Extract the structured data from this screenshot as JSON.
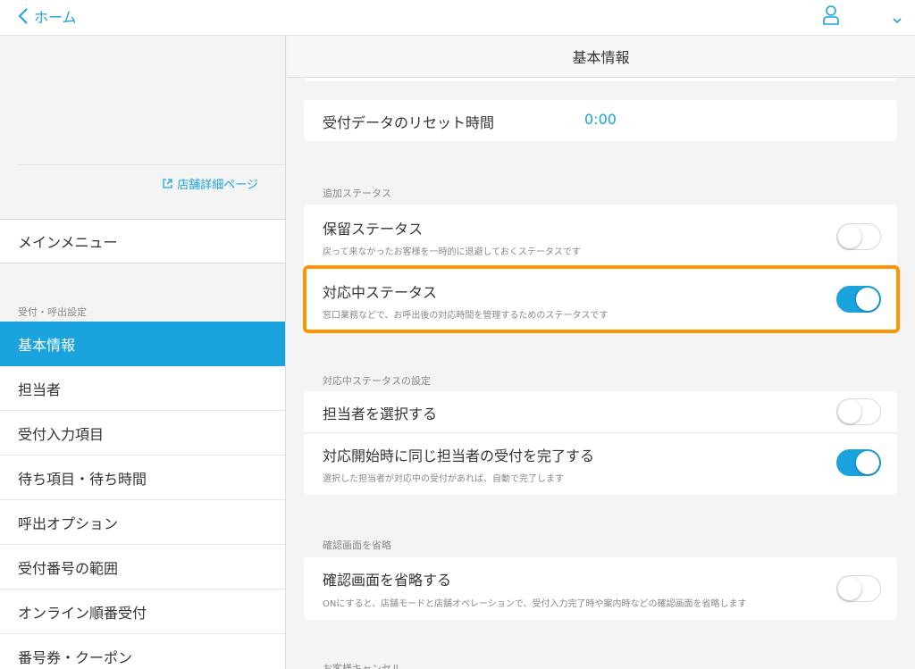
{
  "header": {
    "back_label": "ホーム"
  },
  "sidebar": {
    "store_link_label": "店舗詳細ページ",
    "main_menu_label": "メインメニュー",
    "section_label": "受付・呼出設定",
    "items": [
      {
        "label": "基本情報",
        "active": true
      },
      {
        "label": "担当者"
      },
      {
        "label": "受付入力項目"
      },
      {
        "label": "待ち項目・待ち時間"
      },
      {
        "label": "呼出オプション"
      },
      {
        "label": "受付番号の範囲"
      },
      {
        "label": "オンライン順番受付"
      },
      {
        "label": "番号券・クーポン"
      }
    ]
  },
  "main": {
    "title": "基本情報",
    "reset": {
      "label": "受付データのリセット時間",
      "value": "0:00"
    },
    "additional_status": {
      "group_label": "追加ステータス",
      "hold": {
        "title": "保留ステータス",
        "desc": "戻って来なかったお客様を一時的に退避しておくステータスです",
        "on": false
      },
      "in_progress": {
        "title": "対応中ステータス",
        "desc": "窓口業務などで、お呼出後の対応時間を管理するためのステータスです",
        "on": true
      }
    },
    "in_progress_settings": {
      "group_label": "対応中ステータスの設定",
      "select_staff": {
        "title": "担当者を選択する",
        "on": false
      },
      "auto_complete": {
        "title": "対応開始時に同じ担当者の受付を完了する",
        "desc": "選択した担当者が対応中の受付があれば、自動で完了します",
        "on": true
      }
    },
    "skip_confirm": {
      "group_label": "確認画面を省略",
      "row": {
        "title": "確認画面を省略する",
        "desc": "ONにすると、店舗モードと店舗オペレーションで、受付入力完了時や案内時などの確認画面を省略します",
        "on": false
      }
    },
    "next_group_label": "お客様キャンセル"
  },
  "colors": {
    "accent": "#1aa3dc",
    "highlight": "#ff9500"
  }
}
